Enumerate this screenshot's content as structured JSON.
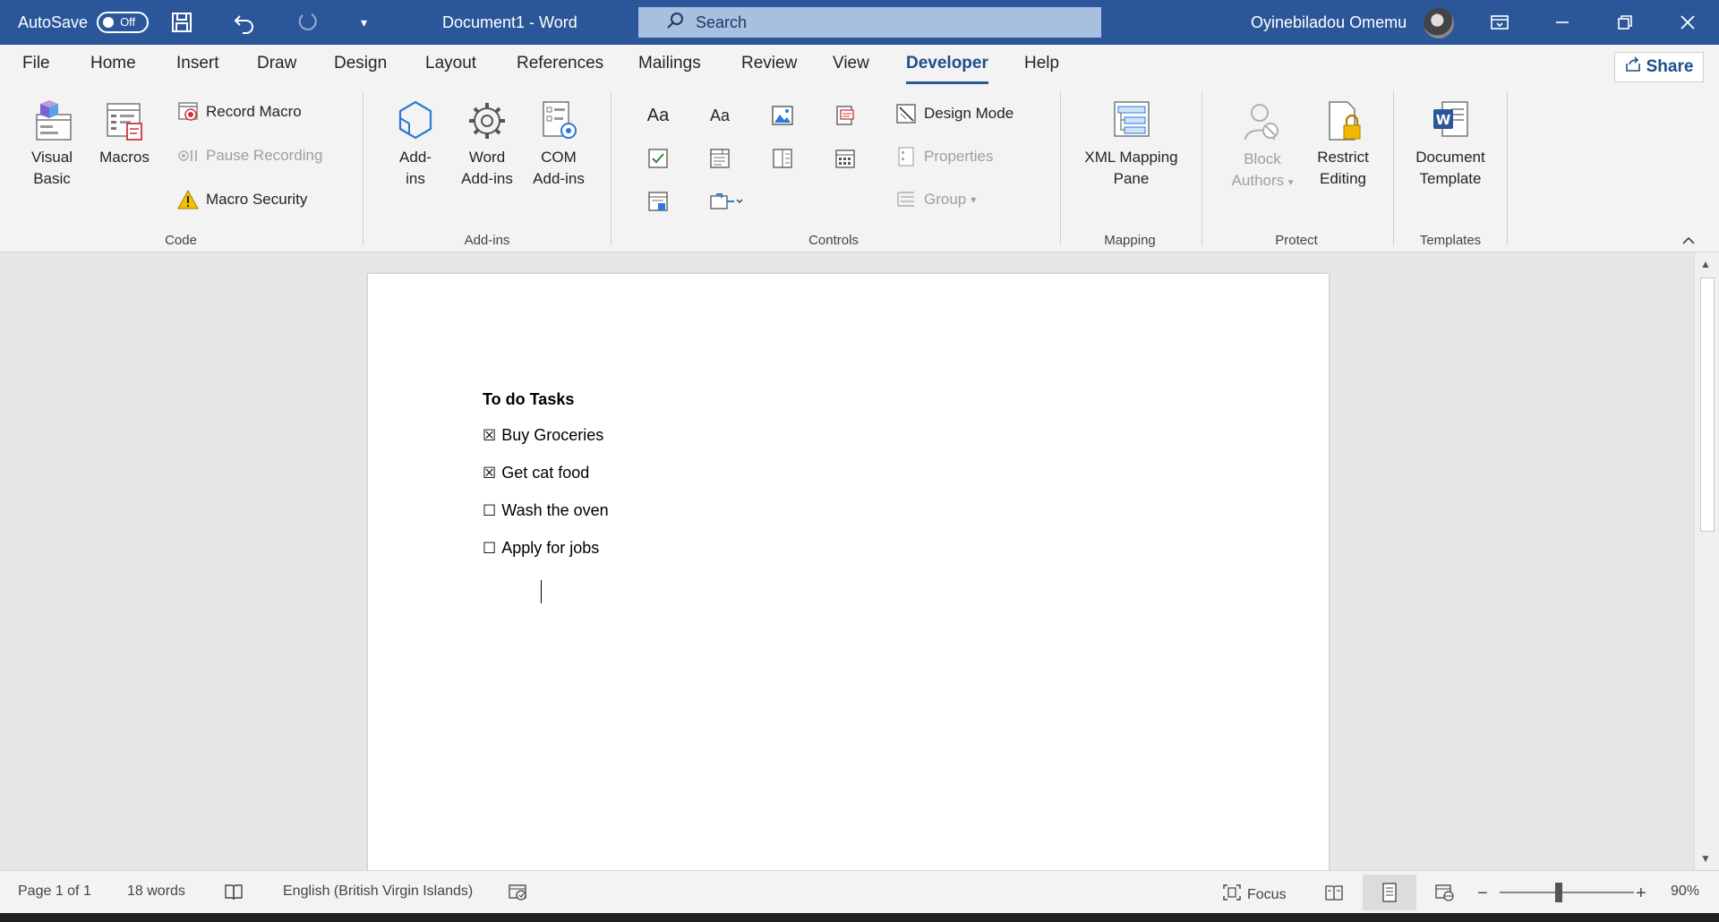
{
  "titlebar": {
    "autosave_label": "AutoSave",
    "autosave_state": "Off",
    "document_title": "Document1  -  Word",
    "search_placeholder": "Search",
    "user_name": "Oyinebiladou Omemu"
  },
  "tabs": [
    {
      "label": "File"
    },
    {
      "label": "Home"
    },
    {
      "label": "Insert"
    },
    {
      "label": "Draw"
    },
    {
      "label": "Design"
    },
    {
      "label": "Layout"
    },
    {
      "label": "References"
    },
    {
      "label": "Mailings"
    },
    {
      "label": "Review"
    },
    {
      "label": "View"
    },
    {
      "label": "Developer",
      "active": true
    },
    {
      "label": "Help"
    }
  ],
  "share_label": "Share",
  "ribbon": {
    "code": {
      "group_label": "Code",
      "visual_basic": "Visual Basic",
      "visual_basic_l1": "Visual",
      "visual_basic_l2": "Basic",
      "macros": "Macros",
      "record_macro": "Record Macro",
      "pause_recording": "Pause Recording",
      "macro_security": "Macro Security"
    },
    "addins": {
      "group_label": "Add-ins",
      "addins_l1": "Add-",
      "addins_l2": "ins",
      "word_addins_l1": "Word",
      "word_addins_l2": "Add-ins",
      "com_addins_l1": "COM",
      "com_addins_l2": "Add-ins"
    },
    "controls": {
      "group_label": "Controls",
      "rich_text_glyph": "Aa",
      "plain_text_glyph": "Aa",
      "design_mode": "Design Mode",
      "properties": "Properties",
      "group": "Group"
    },
    "mapping": {
      "group_label": "Mapping",
      "xml_l1": "XML Mapping",
      "xml_l2": "Pane"
    },
    "protect": {
      "group_label": "Protect",
      "block_l1": "Block",
      "block_l2": "Authors",
      "restrict_l1": "Restrict",
      "restrict_l2": "Editing"
    },
    "templates": {
      "group_label": "Templates",
      "doc_l1": "Document",
      "doc_l2": "Template"
    }
  },
  "document": {
    "title": "To do Tasks",
    "tasks": [
      {
        "label": "Buy Groceries",
        "checked": true,
        "glyph": "☒"
      },
      {
        "label": "Get cat food",
        "checked": true,
        "glyph": "☒"
      },
      {
        "label": "Wash the oven",
        "checked": false,
        "glyph": "☐"
      },
      {
        "label": "Apply for jobs",
        "checked": false,
        "glyph": "☐"
      }
    ]
  },
  "statusbar": {
    "page": "Page 1 of 1",
    "words": "18 words",
    "language": "English (British Virgin Islands)",
    "focus": "Focus",
    "zoom_percent": "90%",
    "zoom_value": 90
  },
  "colors": {
    "titlebar": "#2b579a",
    "accent": "#1e4e8c"
  }
}
